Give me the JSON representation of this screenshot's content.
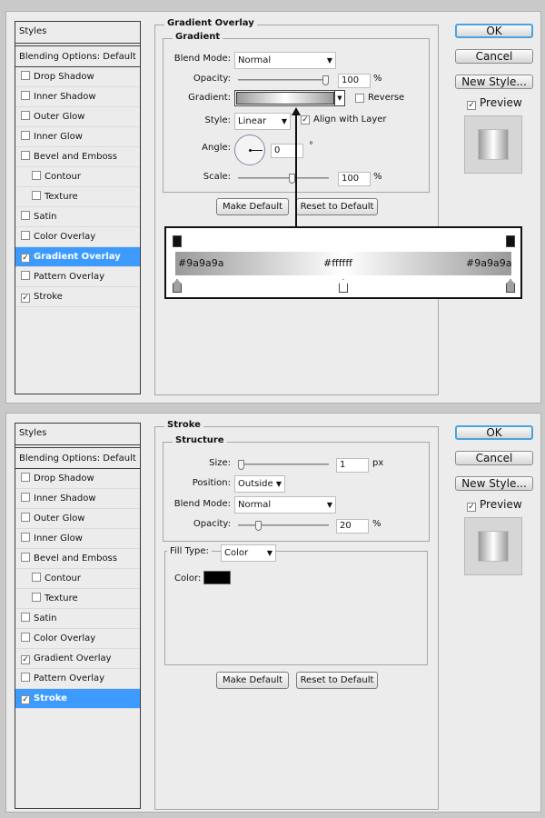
{
  "common": {
    "styles_header": "Styles",
    "blending_options": "Blending Options: Default",
    "items": [
      {
        "label": "Drop Shadow",
        "sub": false
      },
      {
        "label": "Inner Shadow",
        "sub": false
      },
      {
        "label": "Outer Glow",
        "sub": false
      },
      {
        "label": "Inner Glow",
        "sub": false
      },
      {
        "label": "Bevel and Emboss",
        "sub": false
      },
      {
        "label": "Contour",
        "sub": true
      },
      {
        "label": "Texture",
        "sub": true
      },
      {
        "label": "Satin",
        "sub": false
      },
      {
        "label": "Color Overlay",
        "sub": false
      },
      {
        "label": "Gradient Overlay",
        "sub": false
      },
      {
        "label": "Pattern Overlay",
        "sub": false
      },
      {
        "label": "Stroke",
        "sub": false
      }
    ],
    "buttons": {
      "ok": "OK",
      "cancel": "Cancel",
      "new_style": "New Style...",
      "preview": "Preview",
      "make_default": "Make Default",
      "reset_default": "Reset to Default"
    },
    "check_glyph": "✓",
    "arrow_glyph": "▼"
  },
  "dialog1": {
    "checked": [
      9,
      11
    ],
    "active": 9,
    "section_title": "Gradient Overlay",
    "group_title": "Gradient",
    "blend_mode_label": "Blend Mode:",
    "blend_mode_value": "Normal",
    "opacity_label": "Opacity:",
    "opacity_value": "100",
    "opacity_unit": "%",
    "opacity_level": 1.0,
    "gradient_label": "Gradient:",
    "reverse_label": "Reverse",
    "style_label": "Style:",
    "style_value": "Linear",
    "align_label": "Align with Layer",
    "angle_label": "Angle:",
    "angle_value": "0",
    "angle_unit": "°",
    "scale_label": "Scale:",
    "scale_value": "100",
    "scale_unit": "%",
    "scale_level": 0.6,
    "callout": {
      "left_color": "#9a9a9a",
      "mid_color": "#ffffff",
      "left_label": "#9a9a9a",
      "mid_label": "#ffffff",
      "right_label": "#9a9a9a"
    }
  },
  "dialog2": {
    "checked": [
      9,
      11
    ],
    "active": 11,
    "section_title": "Stroke",
    "group_title": "Structure",
    "size_label": "Size:",
    "size_value": "1",
    "size_unit": "px",
    "size_level": 0.0,
    "position_label": "Position:",
    "position_value": "Outside",
    "blend_mode_label": "Blend Mode:",
    "blend_mode_value": "Normal",
    "opacity_label": "Opacity:",
    "opacity_value": "20",
    "opacity_unit": "%",
    "opacity_level": 0.2,
    "fill_type_label": "Fill Type:",
    "fill_type_value": "Color",
    "color_label": "Color:",
    "color_value": "#000000"
  }
}
